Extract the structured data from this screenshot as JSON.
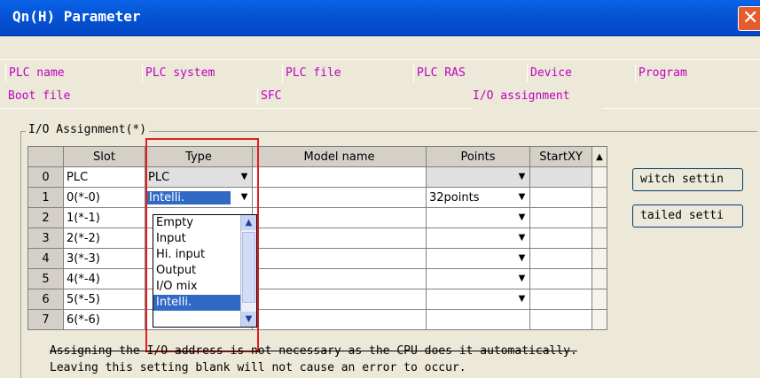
{
  "window": {
    "title": "Qn(H) Parameter",
    "close_glyph": "✕"
  },
  "tabs": {
    "row1": [
      "PLC name",
      "PLC system",
      "PLC file",
      "PLC RAS",
      "Device",
      "Program"
    ],
    "row2": [
      "Boot file",
      "SFC",
      "I/O assignment"
    ]
  },
  "group": {
    "label": "I/O Assignment(*)"
  },
  "table": {
    "headers": [
      "Slot",
      "Type",
      "Model name",
      "Points",
      "StartXY"
    ],
    "rows": [
      {
        "num": "0",
        "slot": "PLC",
        "type": "PLC",
        "model": "",
        "points": "",
        "start": ""
      },
      {
        "num": "1",
        "slot": "0(*-0)",
        "type": "Intelli.",
        "model": "",
        "points": "32points",
        "start": ""
      },
      {
        "num": "2",
        "slot": "1(*-1)",
        "type": "",
        "model": "",
        "points": "",
        "start": ""
      },
      {
        "num": "3",
        "slot": "2(*-2)",
        "type": "",
        "model": "",
        "points": "",
        "start": ""
      },
      {
        "num": "4",
        "slot": "3(*-3)",
        "type": "",
        "model": "",
        "points": "",
        "start": ""
      },
      {
        "num": "5",
        "slot": "4(*-4)",
        "type": "",
        "model": "",
        "points": "",
        "start": ""
      },
      {
        "num": "6",
        "slot": "5(*-5)",
        "type": "",
        "model": "",
        "points": "",
        "start": ""
      },
      {
        "num": "7",
        "slot": "6(*-6)",
        "type": "",
        "model": "",
        "points": "",
        "start": ""
      }
    ]
  },
  "dropdown": {
    "options": [
      "Empty",
      "Input",
      "Hi. input",
      "Output",
      "I/O mix",
      "Intelli."
    ],
    "selected": "Intelli."
  },
  "buttons": {
    "switch": "witch settin",
    "detailed": "tailed setti"
  },
  "messages": {
    "line1": "Assigning the I/O address is not necessary as the CPU does it automatically.",
    "line2": "Leaving this setting blank will not cause an error to occur."
  }
}
